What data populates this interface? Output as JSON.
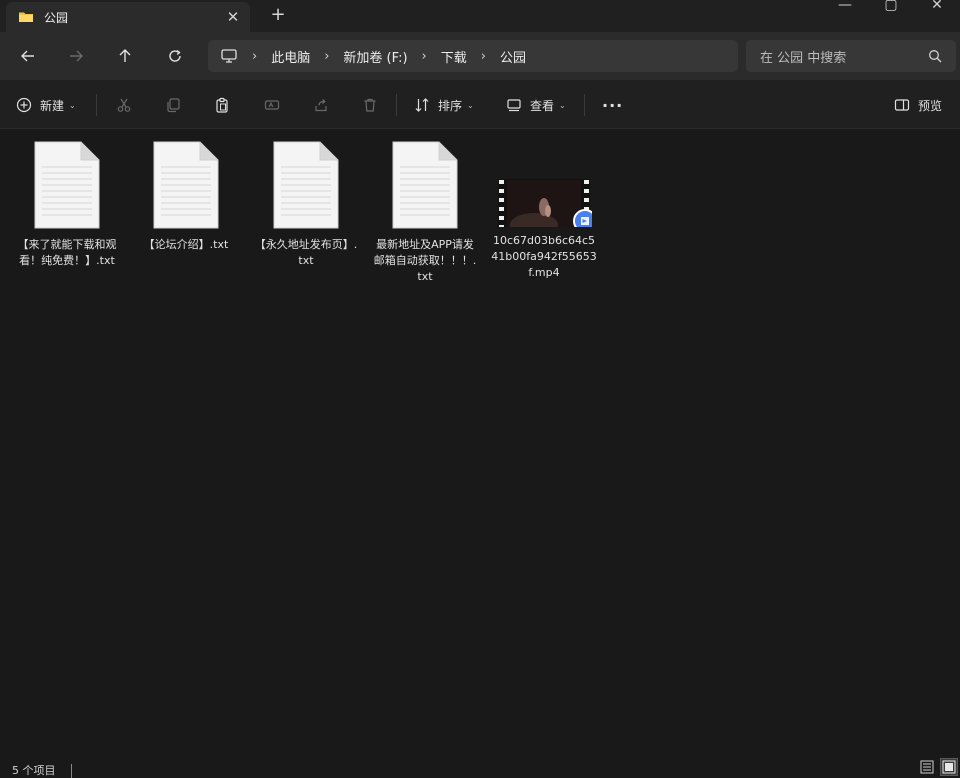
{
  "window": {
    "tab_title": "公园",
    "tab_close": "✕",
    "new_tab": "+",
    "controls": {
      "minimize": "—",
      "maximize": "▢",
      "close": "✕"
    }
  },
  "nav": {
    "breadcrumb": [
      "此电脑",
      "新加卷 (F:)",
      "下载",
      "公园"
    ],
    "separator": "›",
    "search_placeholder": "在 公园 中搜索"
  },
  "toolbar": {
    "new_label": "新建",
    "sort_label": "排序",
    "view_label": "查看",
    "more_label": "···",
    "preview_label": "预览",
    "caret": "⌄"
  },
  "files": [
    {
      "name": "【来了就能下载和观看！纯免费！】.txt",
      "type": "txt"
    },
    {
      "name": "【论坛介绍】.txt",
      "type": "txt"
    },
    {
      "name": "【永久地址发布页】.txt",
      "type": "txt"
    },
    {
      "name": "最新地址及APP请发邮箱自动获取！！！.txt",
      "type": "txt"
    },
    {
      "name": "10c67d03b6c64c541b00fa942f55653f.mp4",
      "type": "mp4"
    }
  ],
  "status": {
    "item_count": "5 个项目"
  },
  "colors": {
    "background": "#191919",
    "navbar": "#2b2b2b",
    "toolbar": "#202020",
    "accent": "#4a7ff0"
  }
}
